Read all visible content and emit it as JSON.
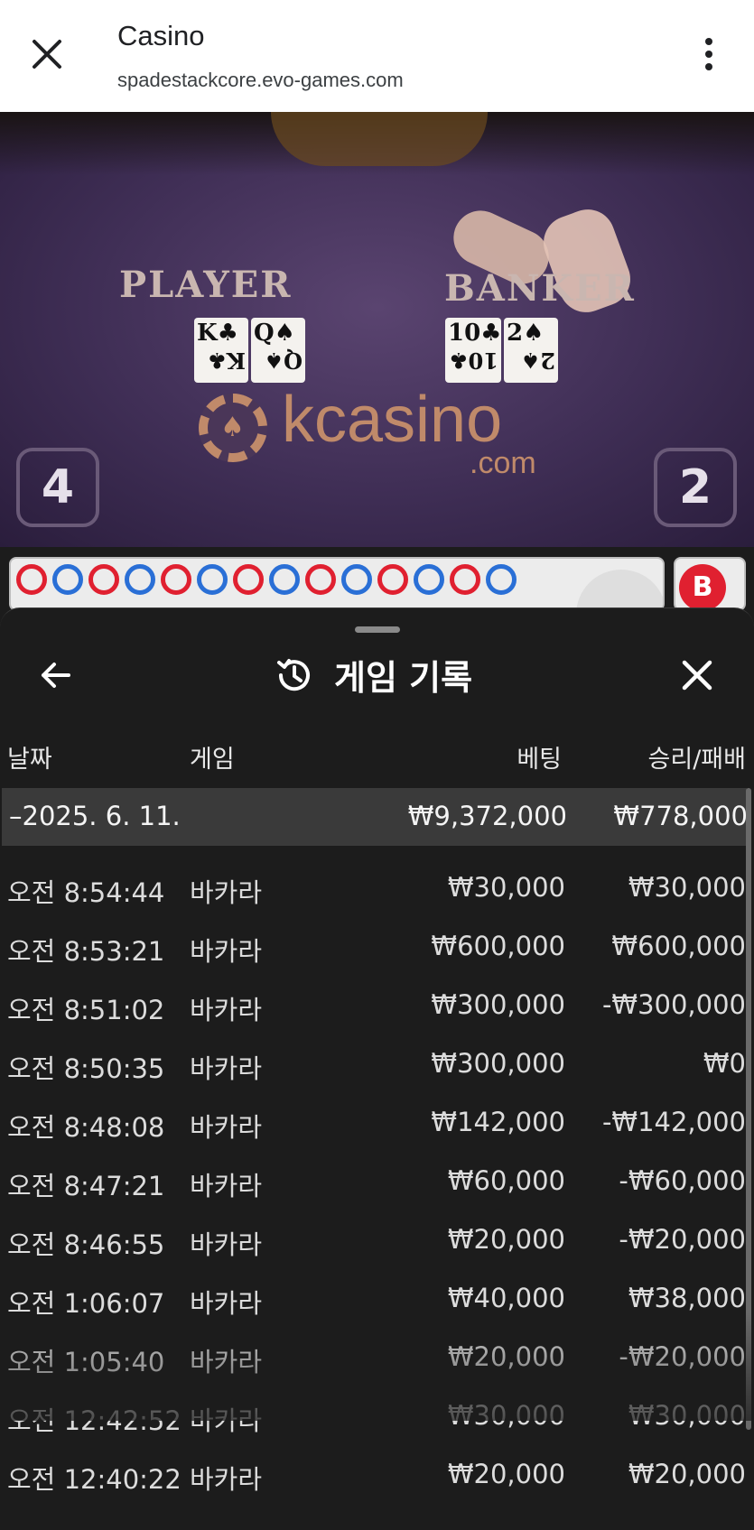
{
  "browser": {
    "title": "Casino",
    "url": "spadestackcore.evo-games.com"
  },
  "video": {
    "player_label": "PLAYER",
    "banker_label": "BANKER",
    "player_cards": [
      "K♣",
      "Q♠"
    ],
    "banker_cards": [
      "10♣",
      "2♠"
    ],
    "brand": "kcasino",
    "brand_domain": ".com",
    "player_score": "4",
    "banker_score": "2"
  },
  "roadmap": {
    "beads": [
      "red",
      "blue",
      "red",
      "blue",
      "red",
      "blue",
      "red",
      "blue",
      "red",
      "blue",
      "red",
      "blue",
      "red",
      "blue"
    ],
    "banker_button": "B"
  },
  "sheet": {
    "title": "게임 기록",
    "columns": {
      "date": "날짜",
      "game": "게임",
      "bet": "베팅",
      "winloss": "승리/패배"
    },
    "group": {
      "date": "–2025. 6. 11.",
      "bet": "₩9,372,000",
      "winloss": "₩778,000"
    },
    "rows": [
      {
        "time": "오전 8:54:44",
        "game": "바카라",
        "bet": "₩30,000",
        "winloss": "₩30,000"
      },
      {
        "time": "오전 8:53:21",
        "game": "바카라",
        "bet": "₩600,000",
        "winloss": "₩600,000"
      },
      {
        "time": "오전 8:51:02",
        "game": "바카라",
        "bet": "₩300,000",
        "winloss": "-₩300,000"
      },
      {
        "time": "오전 8:50:35",
        "game": "바카라",
        "bet": "₩300,000",
        "winloss": "₩0"
      },
      {
        "time": "오전 8:48:08",
        "game": "바카라",
        "bet": "₩142,000",
        "winloss": "-₩142,000"
      },
      {
        "time": "오전 8:47:21",
        "game": "바카라",
        "bet": "₩60,000",
        "winloss": "-₩60,000"
      },
      {
        "time": "오전 8:46:55",
        "game": "바카라",
        "bet": "₩20,000",
        "winloss": "-₩20,000"
      },
      {
        "time": "오전 1:06:07",
        "game": "바카라",
        "bet": "₩40,000",
        "winloss": "₩38,000"
      },
      {
        "time": "오전 1:05:40",
        "game": "바카라",
        "bet": "₩20,000",
        "winloss": "-₩20,000"
      },
      {
        "time": "오전 12:42:52",
        "game": "바카라",
        "bet": "₩30,000",
        "winloss": "₩30,000"
      },
      {
        "time": "오전 12:40:22",
        "game": "바카라",
        "bet": "₩20,000",
        "winloss": "₩20,000"
      }
    ]
  }
}
